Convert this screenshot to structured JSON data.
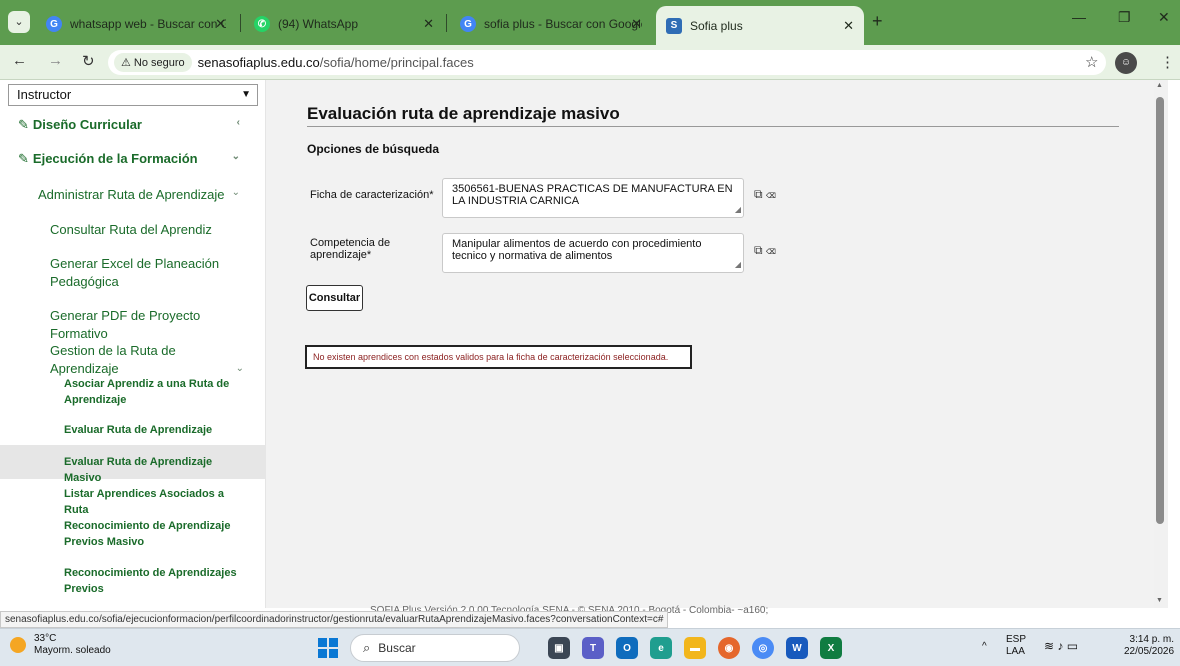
{
  "browser": {
    "tabs": [
      {
        "label": "whatsapp web - Buscar con Goo",
        "favicon": "google-icon",
        "color": "#4285f4"
      },
      {
        "label": "(94) WhatsApp",
        "favicon": "whatsapp-icon",
        "color": "#25d366"
      },
      {
        "label": "sofia plus - Buscar con Google",
        "favicon": "google-icon",
        "color": "#4285f4"
      },
      {
        "label": "Sofia plus",
        "favicon": "sofia-plus-icon",
        "color": "#e87722"
      }
    ],
    "security_label": "No seguro",
    "url_host": "senasofiaplus.edu.co",
    "url_path": "/sofia/home/principal.faces"
  },
  "sidebar": {
    "role": "Instructor",
    "items": [
      {
        "label": "Diseño Curricular"
      },
      {
        "label": "Ejecución de la Formación"
      },
      {
        "label": "Administrar Ruta de Aprendizaje"
      },
      {
        "label": "Consultar Ruta del Aprendiz"
      },
      {
        "label": "Generar Excel de Planeación Pedagógica"
      },
      {
        "label": "Generar PDF de Proyecto Formativo"
      },
      {
        "label": "Gestion de la Ruta de Aprendizaje"
      },
      {
        "label": "Asociar Aprendiz a una Ruta de Aprendizaje"
      },
      {
        "label": "Evaluar Ruta de Aprendizaje"
      },
      {
        "label": "Evaluar Ruta de Aprendizaje Masivo"
      },
      {
        "label": "Listar Aprendices Asociados a Ruta"
      },
      {
        "label": "Reconocimiento de Aprendizaje Previos Masivo"
      },
      {
        "label": "Reconocimiento de Aprendizajes Previos"
      }
    ]
  },
  "main": {
    "title": "Evaluación ruta de aprendizaje masivo",
    "section": "Opciones de búsqueda",
    "ficha_label": "Ficha de caracterización*",
    "ficha_value": "3506561-BUENAS PRACTICAS DE MANUFACTURA EN LA INDUSTRIA CARNICA",
    "competencia_label": "Competencia de aprendizaje*",
    "competencia_value": "Manipular alimentos de acuerdo con procedimiento tecnico y normativa de alimentos",
    "consultar_label": "Consultar",
    "message": "No existen aprendices con estados validos para la ficha de caracterización seleccionada."
  },
  "footer_text": "SOFIA Plus Versión 2.0.00 Tecnología SENA - © SENA 2010 - Bogotá - Colombia- ~a160;",
  "status_url": "senasofiaplus.edu.co/sofia/ejecucionformacion/perfilcoordinadorinstructor/gestionruta/evaluarRutaAprendizajeMasivo.faces?conversationContext=c#",
  "taskbar": {
    "temperature": "33°C",
    "weather": "Mayorm. soleado",
    "search_placeholder": "Buscar",
    "language": "ESP",
    "language_sub": "LAA",
    "time": "3:14 p. m.",
    "date": "22/05/2026"
  }
}
